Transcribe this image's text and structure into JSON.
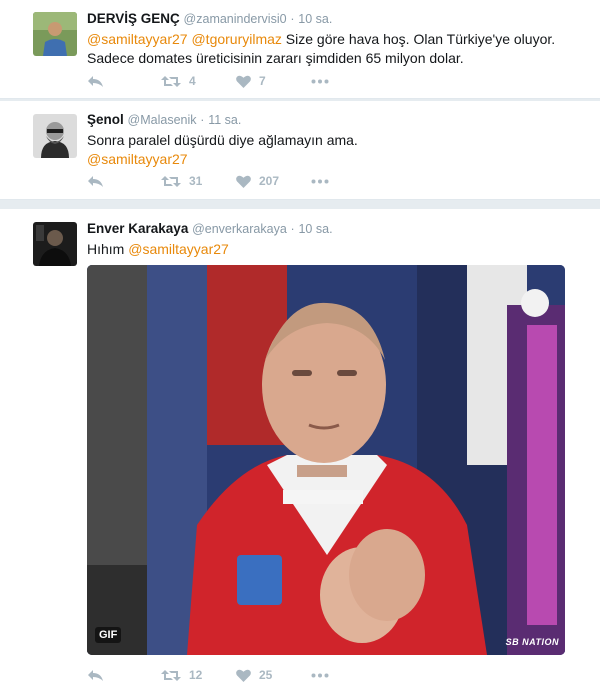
{
  "tweets": [
    {
      "name": "DERVİŞ GENÇ",
      "handle": "@zamanindervisi0",
      "dot": "·",
      "time": "10 sa.",
      "mention1": "@samiltayyar27",
      "mention2": "@tgoruryilmaz",
      "text_rest": " Size göre hava hoş. Olan Türkiye'ye oluyor. Sadece domates üreticisinin zararı şimdiden 65 milyon dolar.",
      "retweets": "4",
      "likes": "7"
    },
    {
      "name": "Şenol",
      "handle": "@Malasenik",
      "dot": "·",
      "time": "11 sa.",
      "text": "Sonra paralel düşürdü diye ağlamayın ama.",
      "mention1": "@samiltayyar27",
      "retweets": "31",
      "likes": "207"
    },
    {
      "name": "Enver Karakaya",
      "handle": "@enverkarakaya",
      "dot": "·",
      "time": "10 sa.",
      "text": "Hıhım ",
      "mention1": "@samiltayyar27",
      "media_badge": "GIF",
      "media_watermark": "SB NATION",
      "retweets": "12",
      "likes": "25"
    }
  ],
  "colors": {
    "mention": "#e8890b",
    "action_gray": "#aab8c2",
    "handle_gray": "#8899a6",
    "background": "#e6ecf0"
  },
  "icons": [
    "reply-icon",
    "retweet-icon",
    "like-icon",
    "more-icon"
  ]
}
